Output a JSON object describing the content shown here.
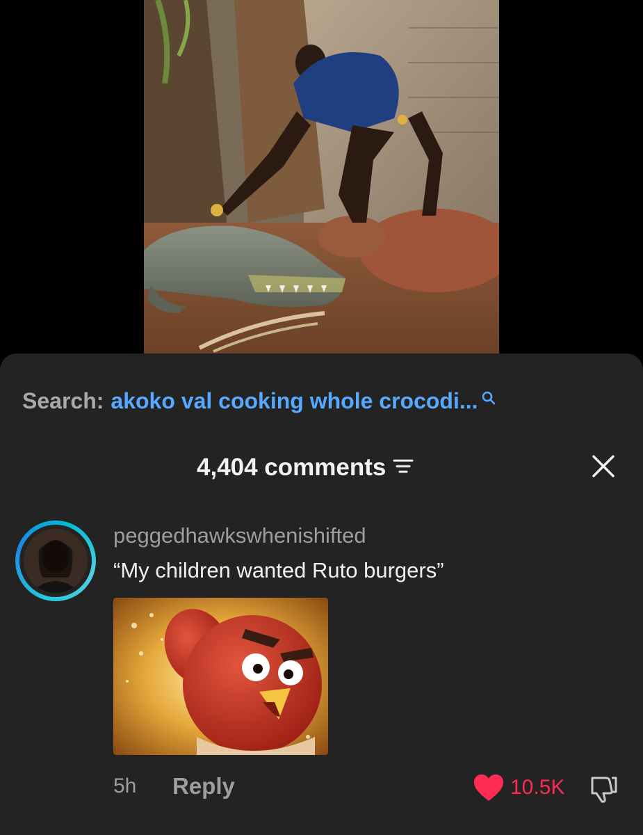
{
  "search": {
    "label": "Search:",
    "query": "akoko val cooking whole crocodi..."
  },
  "comments_header": {
    "count_label": "4,404 comments"
  },
  "comment": {
    "username": "peggedhawkswhenishifted",
    "text": "“My children wanted Ruto burgers”",
    "timestamp": "5h",
    "reply_label": "Reply",
    "like_count": "10.5K"
  },
  "icons": {
    "search": "search-icon",
    "sort": "sort-filter-icon",
    "close": "close-icon",
    "like": "heart-icon",
    "dislike": "thumbs-down-icon"
  },
  "colors": {
    "sheet_background": "#232323",
    "search_query": "#57a8ff",
    "like_red": "#fe2c55",
    "avatar_ring": "#26c6da",
    "muted_text": "#9e9e9e"
  }
}
